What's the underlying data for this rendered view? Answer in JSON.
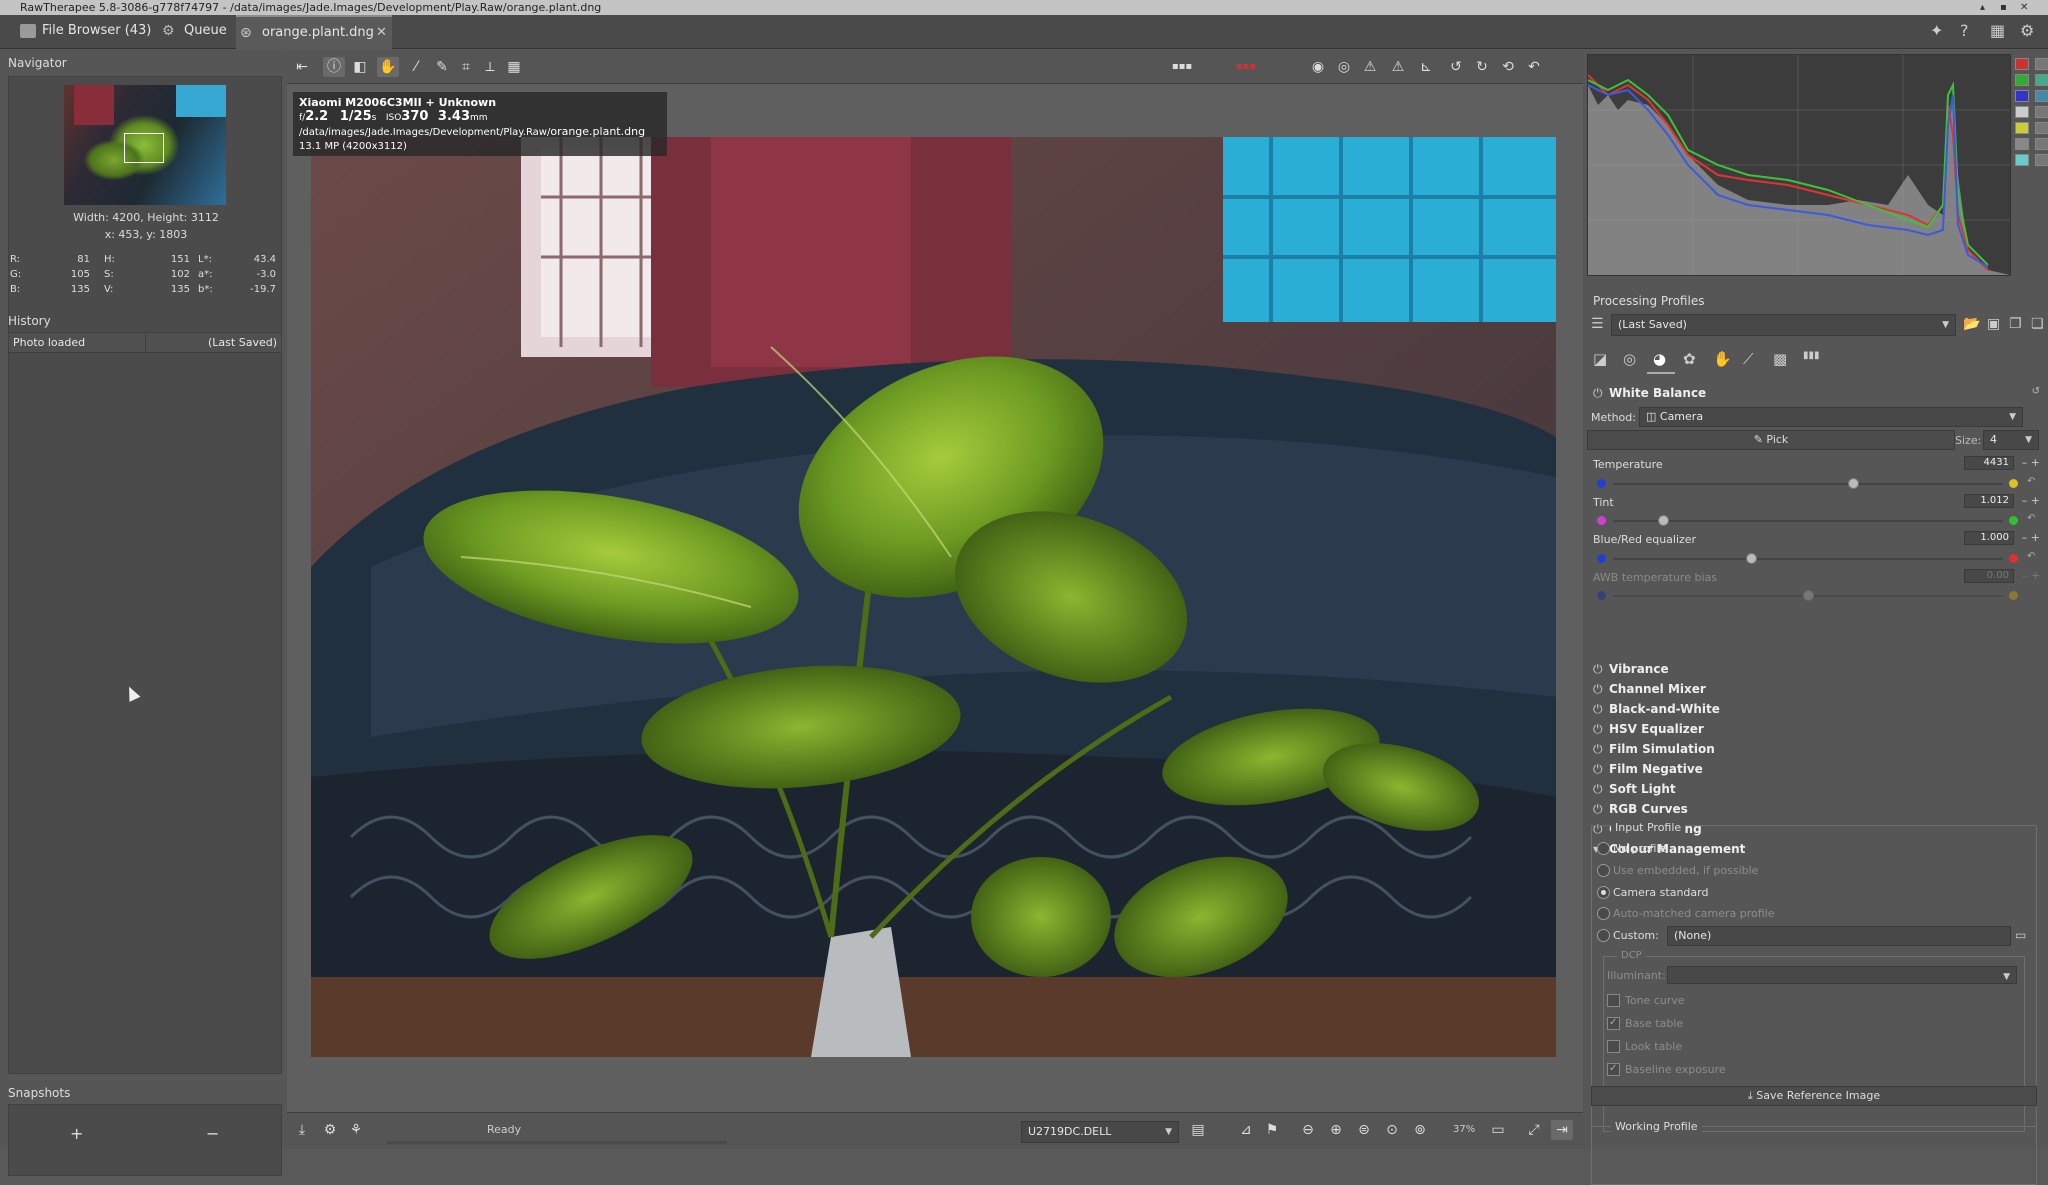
{
  "window": {
    "title": "RawTherapee 5.8-3086-g778f74797 - /data/images/Jade.Images/Development/Play.Raw/orange.plant.dng"
  },
  "tabs": [
    {
      "label": "File Browser (43)"
    },
    {
      "label": "Queue"
    },
    {
      "label": "orange.plant.dng"
    }
  ],
  "navigator": {
    "title": "Navigator",
    "size": "Width: 4200, Height: 3112",
    "coords": "x: 453, y: 1803",
    "readout": {
      "R": "81",
      "G": "105",
      "B": "135",
      "H": "151",
      "S": "102",
      "V": "135",
      "L": "43.4",
      "a": "-3.0",
      "b": "-19.7",
      "R_lbl": "R:",
      "G_lbl": "G:",
      "B_lbl": "B:",
      "H_lbl": "H:",
      "S_lbl": "S:",
      "V_lbl": "V:",
      "L_lbl": "L*:",
      "a_lbl": "a*:",
      "b_lbl": "b*:"
    }
  },
  "history": {
    "title": "History",
    "item": "Photo loaded",
    "item_state": "(Last Saved)"
  },
  "snapshots": {
    "title": "Snapshots",
    "add": "+",
    "remove": "−"
  },
  "image_info": {
    "camera": "Xiaomi M2006C3MII + Unknown",
    "fnum_prefix": "f/",
    "fnum": "2.2",
    "shutter": "1/25",
    "shutter_unit": "s",
    "iso_prefix": "ISO",
    "iso": "370",
    "focal": "3.43",
    "focal_unit": "mm",
    "path_prefix": "/data/images/Jade.Images/Development/Play.Raw/",
    "path_file": "orange.plant.dng",
    "mp": "13.1 MP (4200x3112)"
  },
  "statusbar": {
    "status": "Ready",
    "monitor_profile": "U2719DC.DELL",
    "zoom": "37%"
  },
  "processing_profiles": {
    "title": "Processing Profiles",
    "current": "(Last Saved)"
  },
  "white_balance": {
    "title": "White Balance",
    "method_label": "Method:",
    "method_value": "Camera",
    "pick_label": "Pick",
    "size_label": "Size:",
    "size_value": "4",
    "temperature": {
      "label": "Temperature",
      "value": "4431",
      "level": 0.62
    },
    "tint": {
      "label": "Tint",
      "value": "1.012",
      "level": 0.12
    },
    "bluered": {
      "label": "Blue/Red equalizer",
      "value": "1.000",
      "level": 0.35
    },
    "awb": {
      "label": "AWB temperature bias",
      "value": "0.00",
      "level": 0.5
    }
  },
  "tools": [
    {
      "label": "Vibrance"
    },
    {
      "label": "Channel Mixer"
    },
    {
      "label": "Black-and-White"
    },
    {
      "label": "HSV Equalizer"
    },
    {
      "label": "Film Simulation"
    },
    {
      "label": "Film Negative"
    },
    {
      "label": "Soft Light"
    },
    {
      "label": "RGB Curves"
    },
    {
      "label": "Colour Toning"
    },
    {
      "label": "Colour Management"
    }
  ],
  "colour_management": {
    "input_profile_title": "Input Profile",
    "no_profile": "No profile",
    "use_embedded": "Use embedded, if possible",
    "camera_standard": "Camera standard",
    "auto_matched": "Auto-matched camera profile",
    "custom_label": "Custom:",
    "custom_value": "(None)",
    "dcp_title": "DCP",
    "illuminant_label": "Illuminant:",
    "tone_curve": "Tone curve",
    "base_table": "Base table",
    "look_table": "Look table",
    "baseline_exposure": "Baseline exposure",
    "save_reference": "Save Reference Image",
    "working_profile_title": "Working Profile"
  },
  "colors": {
    "accent": "#8c8c8c",
    "panel": "#565656",
    "temp_warm": "#e0c020",
    "temp_cool": "#2040d0",
    "tint_magenta": "#d040d0",
    "tint_green": "#30c030",
    "red": "#e03030"
  }
}
